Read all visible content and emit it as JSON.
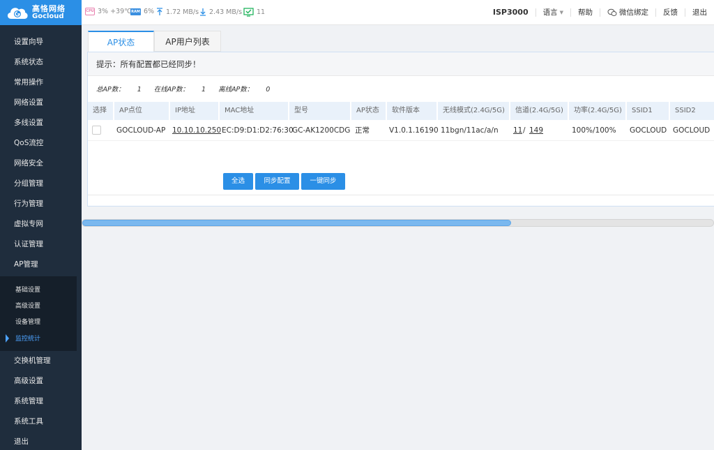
{
  "logo": {
    "cn": "高恪网络",
    "en": "Gocloud"
  },
  "status": {
    "cpu_icon": "CPU",
    "cpu_text": "3% +39℃",
    "ram_icon": "RAM",
    "ram_text": "6%",
    "upload_text": "1.72 MB/s",
    "download_text": "2.43 MB/s",
    "connections_text": "11"
  },
  "header": {
    "model": "ISP3000",
    "language": "语言",
    "help": "帮助",
    "wechat": "微信绑定",
    "feedback": "反馈",
    "logout": "退出"
  },
  "sidebar": {
    "items": [
      {
        "label": "设置向导"
      },
      {
        "label": "系统状态"
      },
      {
        "label": "常用操作"
      },
      {
        "label": "网络设置"
      },
      {
        "label": "多线设置"
      },
      {
        "label": "QoS流控"
      },
      {
        "label": "网络安全"
      },
      {
        "label": "分组管理"
      },
      {
        "label": "行为管理"
      },
      {
        "label": "虚拟专网"
      },
      {
        "label": "认证管理"
      },
      {
        "label": "AP管理"
      }
    ],
    "sub_items": [
      {
        "label": "基础设置"
      },
      {
        "label": "高级设置"
      },
      {
        "label": "设备管理"
      },
      {
        "label": "监控统计"
      }
    ],
    "bottom_items": [
      {
        "label": "交换机管理"
      },
      {
        "label": "高级设置"
      },
      {
        "label": "系统管理"
      },
      {
        "label": "系统工具"
      },
      {
        "label": "退出"
      }
    ]
  },
  "tabs": [
    {
      "label": "AP状态"
    },
    {
      "label": "AP用户列表"
    }
  ],
  "panel": {
    "hint": "提示：所有配置都已经同步！",
    "total_label": "总AP数：",
    "total_value": "1",
    "online_label": "在线AP数：",
    "online_value": "1",
    "offline_label": "离线AP数：",
    "offline_value": "0",
    "columns": [
      "选择",
      "AP点位",
      "IP地址",
      "MAC地址",
      "型号",
      "AP状态",
      "软件版本",
      "无线模式(2.4G/5G)",
      "信道(2.4G/5G)",
      "功率(2.4G/5G)",
      "SSID1",
      "SSID2"
    ],
    "row": {
      "name": "GOCLOUD-AP",
      "ip": "10.10.10.250",
      "mac": "EC:D9:D1:D2:76:30",
      "model": "GC-AK1200CDG",
      "status": "正常",
      "version": "V1.0.1.16190",
      "mode": "11bgn/11ac/a/n",
      "channel_24": "11",
      "channel_sep": "/",
      "channel_5": "149",
      "power": "100%/100%",
      "ssid1": "GOCLOUD",
      "ssid2": "GOCLOUD"
    },
    "buttons": {
      "select_all": "全选",
      "sync_config": "同步配置",
      "one_click_sync": "一键同步"
    }
  },
  "progress": {
    "percent": 68
  }
}
